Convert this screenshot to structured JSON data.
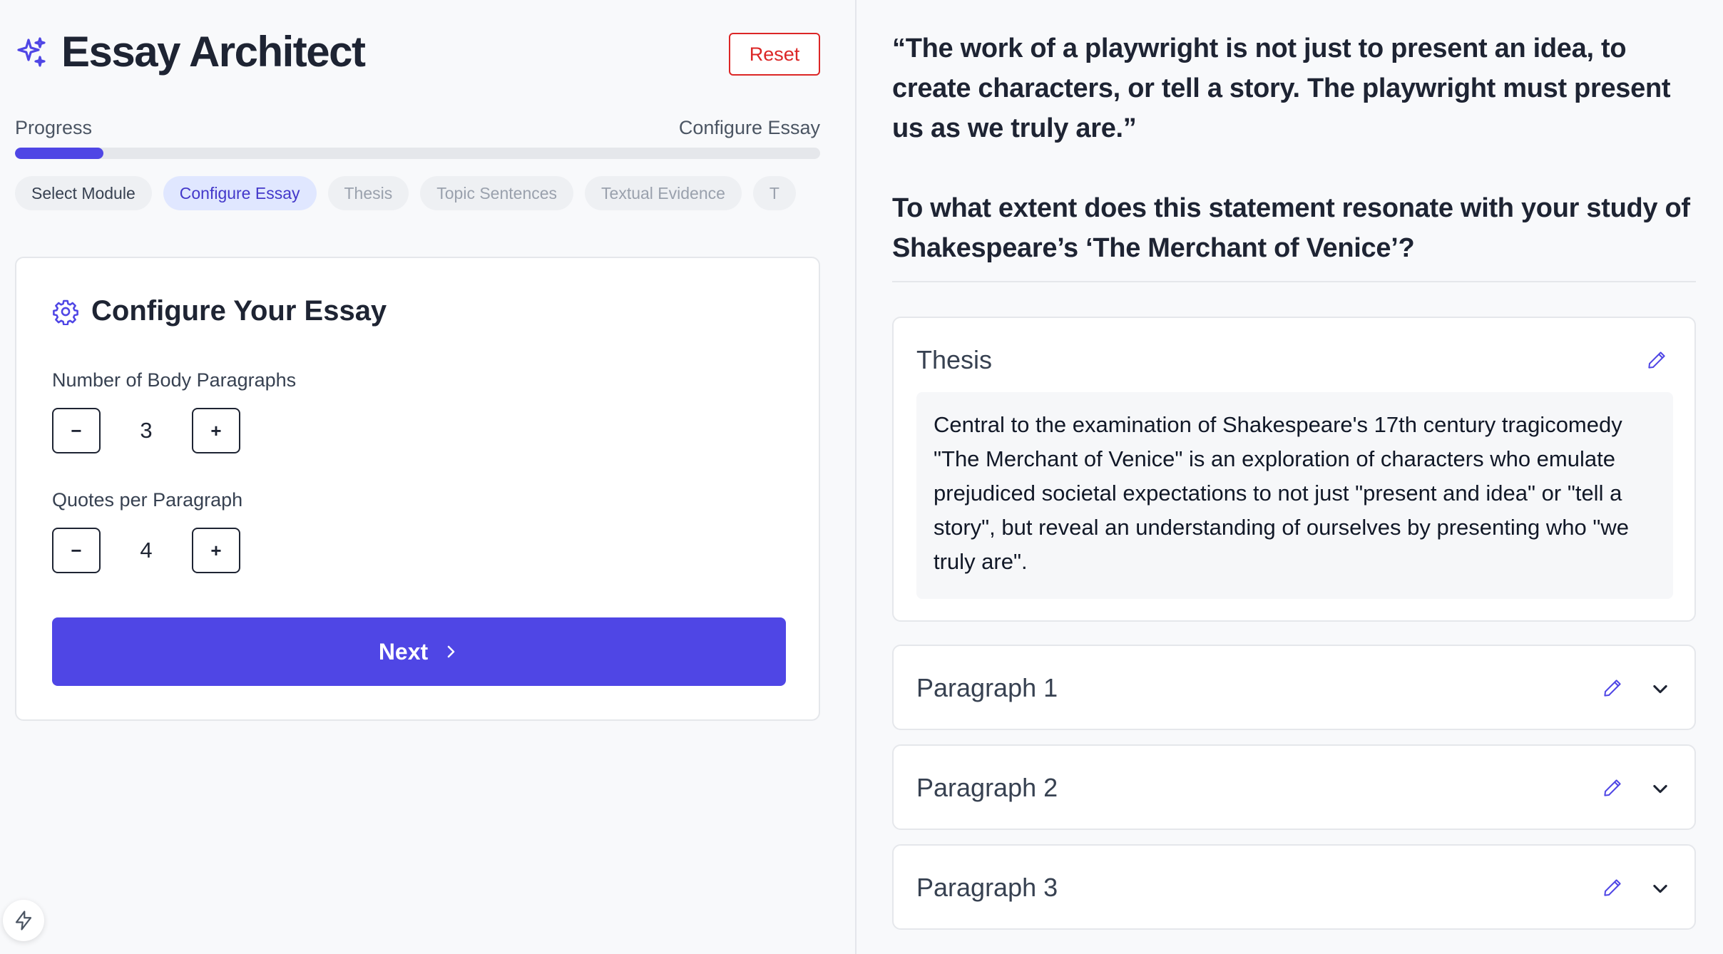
{
  "header": {
    "app_title": "Essay Architect",
    "reset_label": "Reset"
  },
  "progress": {
    "label": "Progress",
    "current_step_label": "Configure Essay",
    "fraction": 0.11
  },
  "steps": [
    {
      "label": "Select Module",
      "state": "done"
    },
    {
      "label": "Configure Essay",
      "state": "active"
    },
    {
      "label": "Thesis",
      "state": "pending"
    },
    {
      "label": "Topic Sentences",
      "state": "pending"
    },
    {
      "label": "Textual Evidence",
      "state": "pending"
    },
    {
      "label": "T",
      "state": "pending"
    }
  ],
  "config": {
    "title": "Configure Your Essay",
    "body_paragraphs_label": "Number of Body Paragraphs",
    "body_paragraphs_value": "3",
    "quotes_label": "Quotes per Paragraph",
    "quotes_value": "4",
    "decrement_symbol": "−",
    "increment_symbol": "+",
    "next_label": "Next"
  },
  "prompt": {
    "quote": "“The work of a playwright is not just to present an idea, to create characters, or tell a story. The playwright must present us as we truly are.”",
    "question": "To what extent does this statement resonate with your study of Shakespeare’s ‘The Merchant of Venice’?"
  },
  "thesis": {
    "title": "Thesis",
    "text": "Central to the examination of Shakespeare's 17th century tragicomedy \"The Merchant of Venice\" is an exploration of characters who emulate prejudiced societal expectations to not just \"present and idea\" or \"tell a story\", but reveal an understanding of ourselves by presenting who \"we truly are\"."
  },
  "paragraphs": [
    {
      "title": "Paragraph 1"
    },
    {
      "title": "Paragraph 2"
    },
    {
      "title": "Paragraph 3"
    }
  ],
  "colors": {
    "accent": "#4f46e5",
    "danger": "#dc2626",
    "active_step_bg": "#e0e7ff"
  },
  "icons": {
    "brand": "sparkles-icon",
    "settings": "gear-icon",
    "edit": "pencil-icon",
    "expand": "chevron-down-icon",
    "next": "chevron-right-icon",
    "badge": "lightning-bolt-icon"
  }
}
